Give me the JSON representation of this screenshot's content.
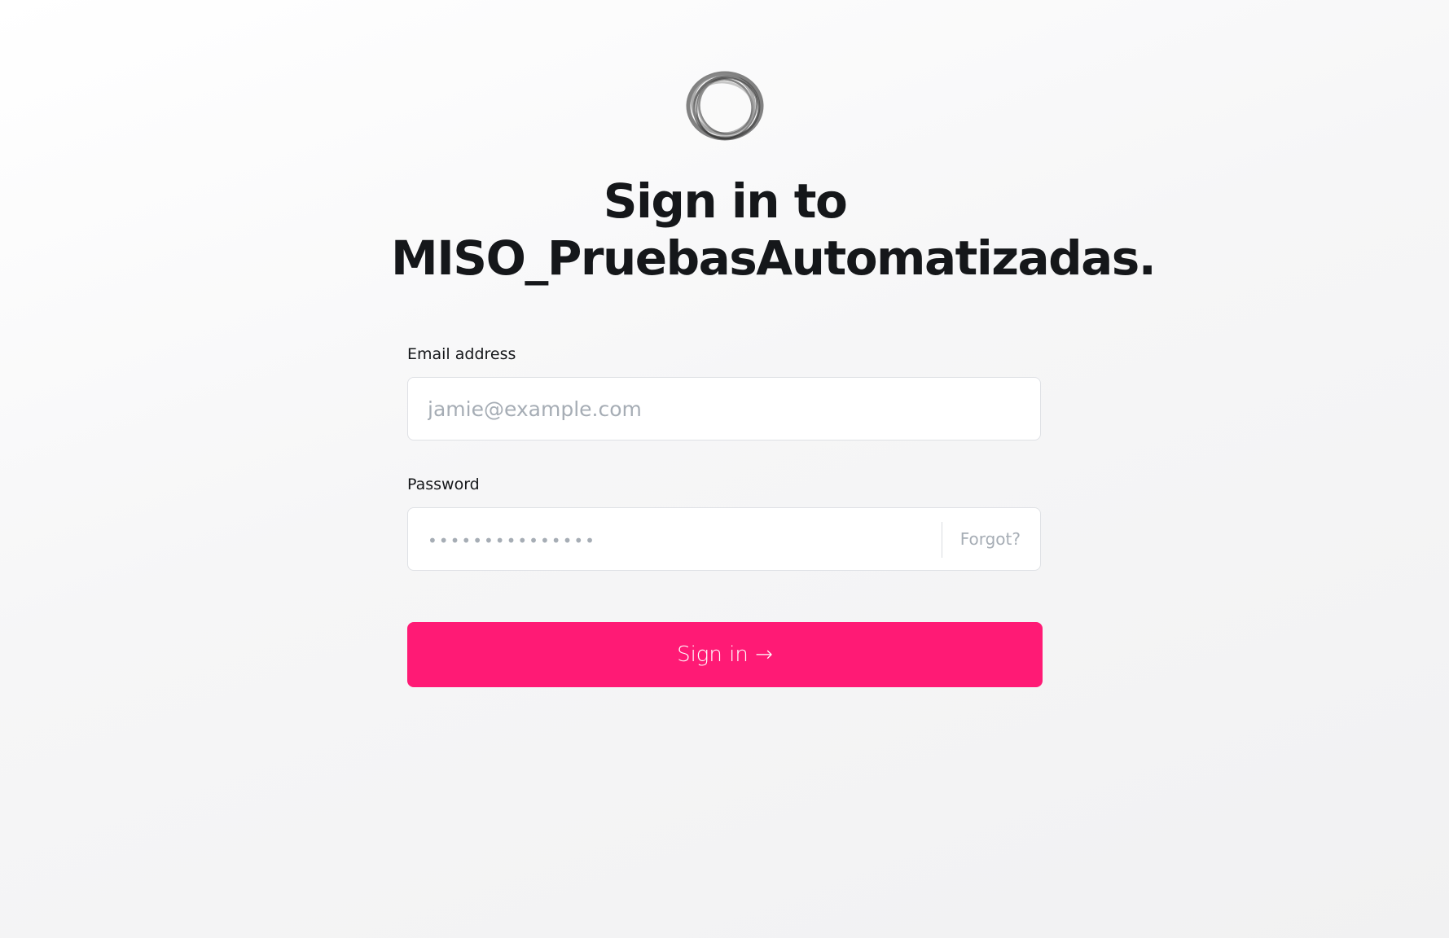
{
  "colors": {
    "accent": "#ff1a75",
    "text": "#15171a",
    "placeholder": "#a6adb5",
    "border": "#dfe1e5"
  },
  "logo": {
    "icon": "ghost-ring-logo"
  },
  "header": {
    "title_line1": "Sign in to",
    "title_line2": "MISO_PruebasAutomatizadas."
  },
  "form": {
    "email": {
      "label": "Email address",
      "value": "",
      "placeholder": "jamie@example.com"
    },
    "password": {
      "label": "Password",
      "value": "",
      "placeholder": "•••••••••••••••",
      "forgot_label": "Forgot?"
    },
    "submit_label": "Sign in →"
  }
}
